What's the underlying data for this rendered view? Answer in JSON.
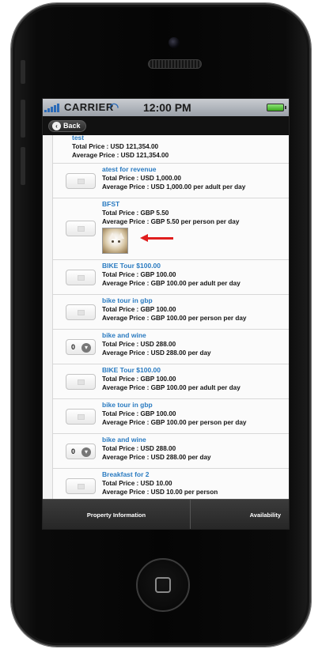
{
  "status": {
    "carrier": "CARRIER",
    "time": "12:00 PM"
  },
  "nav": {
    "back_label": "Back"
  },
  "items": [
    {
      "name": "test",
      "total": "Total Price :  USD 121,354.00",
      "average": "Average Price :  USD 121,354.00"
    },
    {
      "name": "atest for revenue",
      "total": "Total Price :  USD 1,000.00",
      "average": "Average Price :  USD 1,000.00 per adult per day",
      "qty": ""
    },
    {
      "name": "BFST",
      "total": "Total Price :  GBP 5.50",
      "average": "Average Price :  GBP 5.50 per person per day",
      "qty": ""
    },
    {
      "name": "BIKE Tour $100.00",
      "total": "Total Price :  GBP 100.00",
      "average": "Average Price :  GBP 100.00 per adult per day",
      "qty": ""
    },
    {
      "name": "bike tour in gbp",
      "total": "Total Price :  GBP 100.00",
      "average": "Average Price :  GBP 100.00 per person per day",
      "qty": ""
    },
    {
      "name": "bike and wine",
      "total": "Total Price :  USD 288.00",
      "average": "Average Price :  USD 288.00 per day",
      "qty": "0"
    },
    {
      "name": "BIKE Tour $100.00",
      "total": "Total Price :  GBP 100.00",
      "average": "Average Price :  GBP 100.00 per adult per day",
      "qty": ""
    },
    {
      "name": "bike tour in gbp",
      "total": "Total Price :  GBP 100.00",
      "average": "Average Price :  GBP 100.00 per person per day",
      "qty": ""
    },
    {
      "name": "bike and wine",
      "total": "Total Price :  USD 288.00",
      "average": "Average Price :  USD 288.00 per day",
      "qty": "0"
    },
    {
      "name": "Breakfast for 2",
      "total": "Total Price :  USD 10.00",
      "average": "Average Price :  USD 10.00 per person",
      "qty": ""
    }
  ],
  "tabs": [
    {
      "label": "Property Information"
    },
    {
      "label": "Availability"
    }
  ],
  "icons": {
    "back": "chevron-left-icon",
    "dropdown": "chevron-down-icon",
    "signal": "signal-bars-icon",
    "wifi": "wifi-icon",
    "battery": "battery-icon",
    "annotation": "red-arrow-icon"
  },
  "colors": {
    "link": "#2a7bc1",
    "arrow": "#e01e1e",
    "battery": "#3aa81d"
  }
}
